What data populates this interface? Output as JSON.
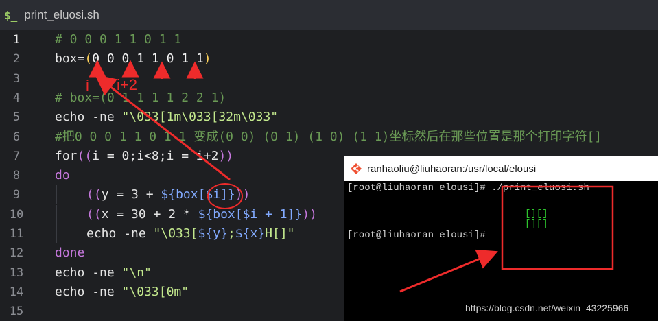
{
  "tab": {
    "icon": "$_",
    "title": "print_eluosi.sh"
  },
  "lines": [
    {
      "n": "1",
      "tokens": [
        {
          "t": "# 0 0 0 1 1 0 1 1",
          "c": "c-com"
        }
      ]
    },
    {
      "n": "2",
      "tokens": [
        {
          "t": "box=",
          "c": "c-op"
        },
        {
          "t": "(",
          "c": "c-p"
        },
        {
          "t": "0 0 0 1 1 0 1 1",
          "c": "c-num"
        },
        {
          "t": ")",
          "c": "c-p"
        }
      ]
    },
    {
      "n": "3",
      "tokens": []
    },
    {
      "n": "4",
      "tokens": [
        {
          "t": "# box=(0 1 1 1 1 2 2 1)",
          "c": "c-com"
        }
      ]
    },
    {
      "n": "5",
      "tokens": [
        {
          "t": "echo ",
          "c": "c-fn"
        },
        {
          "t": "-ne ",
          "c": "c-op"
        },
        {
          "t": "\"\\033[1m\\033[32m\\033\"",
          "c": "c-str"
        }
      ]
    },
    {
      "n": "6",
      "tokens": [
        {
          "t": "#把0 0 0 1 1 0 1 1 变成(0 0) (0 1) (1 0) (1 1)坐标然后在那些位置是那个打印字符[]",
          "c": "c-com"
        }
      ]
    },
    {
      "n": "7",
      "tokens": [
        {
          "t": "for",
          "c": "c-fn"
        },
        {
          "t": "((",
          "c": "c-kw"
        },
        {
          "t": "i = 0;i<8;i = i+2",
          "c": "c-op"
        },
        {
          "t": "))",
          "c": "c-kw"
        }
      ]
    },
    {
      "n": "8",
      "tokens": [
        {
          "t": "do",
          "c": "c-kw"
        }
      ]
    },
    {
      "n": "9",
      "indent": true,
      "tokens": [
        {
          "t": "((",
          "c": "c-kw"
        },
        {
          "t": "y = 3 + ",
          "c": "c-op"
        },
        {
          "t": "${box[$i]}",
          "c": "c-var"
        },
        {
          "t": "))",
          "c": "c-kw"
        }
      ]
    },
    {
      "n": "10",
      "indent": true,
      "tokens": [
        {
          "t": "((",
          "c": "c-kw"
        },
        {
          "t": "x = 30 + 2 * ",
          "c": "c-op"
        },
        {
          "t": "${box[$i + 1]}",
          "c": "c-var"
        },
        {
          "t": "))",
          "c": "c-kw"
        }
      ]
    },
    {
      "n": "11",
      "indent": true,
      "tokens": [
        {
          "t": "echo ",
          "c": "c-fn"
        },
        {
          "t": "-ne ",
          "c": "c-op"
        },
        {
          "t": "\"\\033[",
          "c": "c-str"
        },
        {
          "t": "${y}",
          "c": "c-var"
        },
        {
          "t": ";",
          "c": "c-str"
        },
        {
          "t": "${x}",
          "c": "c-var"
        },
        {
          "t": "H[]\"",
          "c": "c-str"
        }
      ]
    },
    {
      "n": "12",
      "tokens": [
        {
          "t": "done",
          "c": "c-kw"
        }
      ]
    },
    {
      "n": "13",
      "tokens": [
        {
          "t": "echo ",
          "c": "c-fn"
        },
        {
          "t": "-ne ",
          "c": "c-op"
        },
        {
          "t": "\"\\n\"",
          "c": "c-str"
        }
      ]
    },
    {
      "n": "14",
      "tokens": [
        {
          "t": "echo ",
          "c": "c-fn"
        },
        {
          "t": "-ne ",
          "c": "c-op"
        },
        {
          "t": "\"\\033[0m\"",
          "c": "c-str"
        }
      ]
    },
    {
      "n": "15",
      "tokens": []
    }
  ],
  "annotations": {
    "label_i": "i",
    "label_i2": "i+2",
    "color": "#ee2b2b"
  },
  "terminal": {
    "title": "ranhaoliu@liuhaoran:/usr/local/elousi",
    "prompt1": "[root@liuhaoran elousi]# ./print_eluosi.sh",
    "block_row1": "[][]",
    "block_row2": "[][]",
    "prompt2": "[root@liuhaoran elousi]#"
  },
  "watermark": "https://blog.csdn.net/weixin_43225966"
}
